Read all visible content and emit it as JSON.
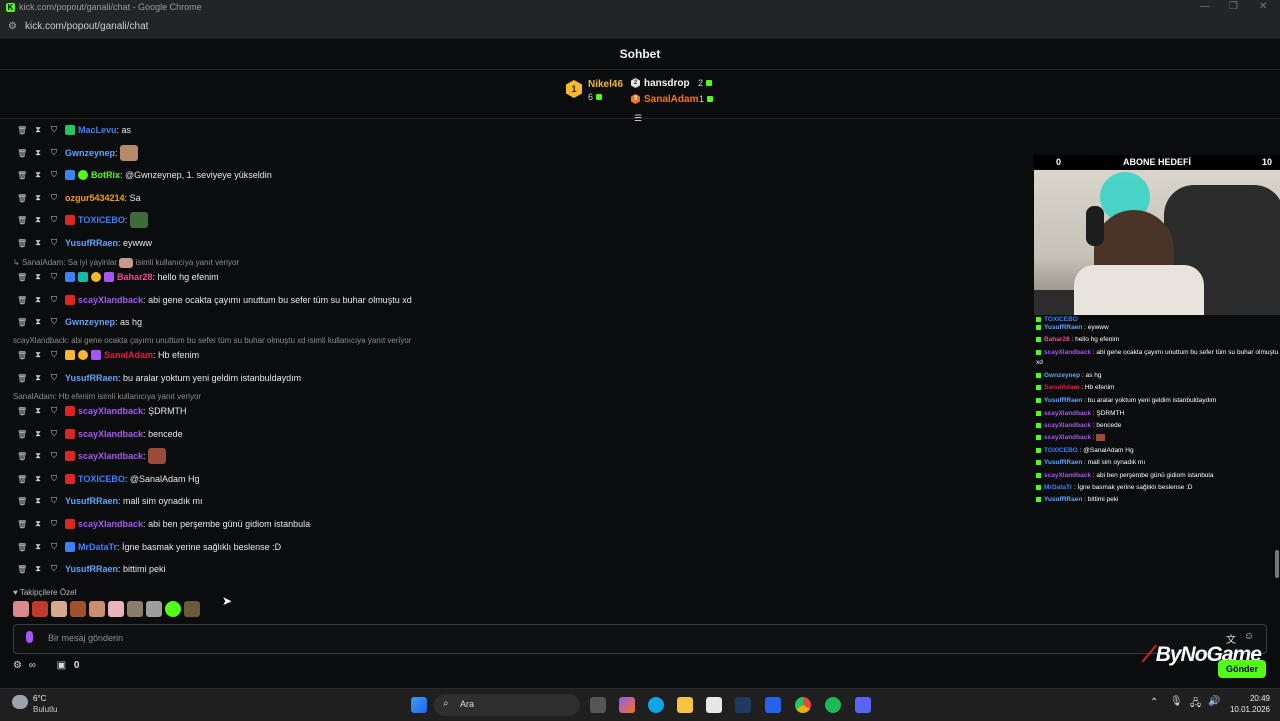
{
  "browser": {
    "title": "kick.com/popout/ganali/chat - Google Chrome",
    "url": "kick.com/popout/ganali/chat"
  },
  "header": {
    "title": "Sohbet"
  },
  "gifters": [
    {
      "name": "Nikel46",
      "count": "6",
      "rank": "1"
    },
    {
      "name": "hansdrop",
      "count": "2"
    },
    {
      "name": "SanalAdam",
      "count": "1"
    }
  ],
  "messages": [
    {
      "user": "MacLevu",
      "text": "as",
      "color": "#3b82f6"
    },
    {
      "user": "Gwnzeynep",
      "text": "",
      "color": "#60a5fa"
    },
    {
      "user": "BotRix",
      "text": "@Gwnzeynep, 1. seviyeye yükseldin",
      "color": "#53fc18"
    },
    {
      "user": "ozgur5434214",
      "text": "Sa",
      "color": "#f59e0b"
    },
    {
      "user": "TOXICEBO",
      "text": "",
      "color": "#3b82f6"
    },
    {
      "user": "YusufRRaen",
      "text": "eywww",
      "color": "#60a5fa"
    },
    {
      "user": "Bahar28",
      "text": "hello hg efenim",
      "color": "#ec4899"
    },
    {
      "user": "scayXlandback",
      "text": "abi gene ocakta çayımı unuttum bu sefer tüm su buhar olmuştu xd",
      "color": "#a855f7"
    },
    {
      "user": "Gwnzeynep",
      "text": "as hg",
      "color": "#60a5fa"
    },
    {
      "user": "SanalAdam",
      "text": "Hb efenim",
      "color": "#e11d48"
    },
    {
      "user": "YusufRRaen",
      "text": "bu aralar yoktum yeni geldim istanbuldaydım",
      "color": "#60a5fa"
    },
    {
      "user": "scayXlandback",
      "text": "ŞDRMTH",
      "color": "#a855f7"
    },
    {
      "user": "scayXlandback",
      "text": "bencede",
      "color": "#a855f7"
    },
    {
      "user": "scayXlandback",
      "text": "",
      "color": "#a855f7"
    },
    {
      "user": "TOXICEBO",
      "text": "@SanalAdam Hg",
      "color": "#3b82f6"
    },
    {
      "user": "YusufRRaen",
      "text": "mall sim oynadık mı",
      "color": "#60a5fa"
    },
    {
      "user": "scayXlandback",
      "text": "abi ben perşembe günü gidiom istanbula",
      "color": "#a855f7"
    },
    {
      "user": "MrDataTr",
      "text": "İgne basmak yerine sağlıklı beslense :D",
      "color": "#3b82f6"
    },
    {
      "user": "YusufRRaen",
      "text": "bittimi peki",
      "color": "#60a5fa"
    }
  ],
  "replies": [
    "SanalAdam: Sa iyi yayinlar",
    "isimli kullanıcıya yanıt veriyor",
    "scayXlandback: abi gene ocakta çayımı unuttum bu sefer tüm su buhar olmuştu xd isimli kullanıcıya yanıt veriyor",
    "SanalAdam: Hb efenim isimli kullanıcıya yanıt veriyor"
  ],
  "followers": {
    "label": "Takipçilere Özel"
  },
  "input": {
    "placeholder": "Bir mesaj gönderin",
    "send_label": "Gönder",
    "count": "0"
  },
  "overlay": {
    "goal_title": "ABONE HEDEFİ",
    "goal_current": "0",
    "goal_target": "10",
    "chat": [
      {
        "user": "TOXICEBO",
        "text": "",
        "color": "#3b82f6"
      },
      {
        "user": "YusufRRaen",
        "text": "eywww",
        "color": "#60a5fa"
      },
      {
        "user": "Bahar28",
        "text": "hello hg efenim",
        "color": "#ec4899"
      },
      {
        "user": "scayXlandback",
        "text": "abi gene ocakta çayımı unuttum bu sefer tüm su buhar olmuştu",
        "color": "#a855f7"
      },
      {
        "user": "",
        "text": "xd",
        "color": "#ffffff"
      },
      {
        "user": "Gwnzeynep",
        "text": "as hg",
        "color": "#60a5fa"
      },
      {
        "user": "SanalAdam",
        "text": "Hb efenim",
        "color": "#e11d48"
      },
      {
        "user": "YusufRRaen",
        "text": "bu aralar yoktum yeni geldim istanbuldaydım",
        "color": "#60a5fa"
      },
      {
        "user": "scayXlandback",
        "text": "ŞDRMTH",
        "color": "#a855f7"
      },
      {
        "user": "scayXlandback",
        "text": "bencede",
        "color": "#a855f7"
      },
      {
        "user": "scayXlandback",
        "text": "",
        "color": "#a855f7"
      },
      {
        "user": "TOXICEBO",
        "text": "@SanalAdam Hg",
        "color": "#3b82f6"
      },
      {
        "user": "YusufRRaen",
        "text": "mall sim oynadık mı",
        "color": "#60a5fa"
      },
      {
        "user": "scayXlandback",
        "text": "abi ben perşembe günü gidiom istanbula",
        "color": "#a855f7"
      },
      {
        "user": "MrDataTr",
        "text": "İgne basmak yerine sağlıklı beslense :D",
        "color": "#3b82f6"
      },
      {
        "user": "YusufRRaen",
        "text": "bittimi peki",
        "color": "#60a5fa"
      }
    ],
    "brand": "ByNoGame"
  },
  "taskbar": {
    "weather_temp": "6°C",
    "weather_cond": "Bulutlu",
    "search_label": "Ara",
    "time": "20:49",
    "date": "10.01.2026"
  },
  "colors": {
    "accent": "#53fc18",
    "background": "#0b0c0d"
  }
}
